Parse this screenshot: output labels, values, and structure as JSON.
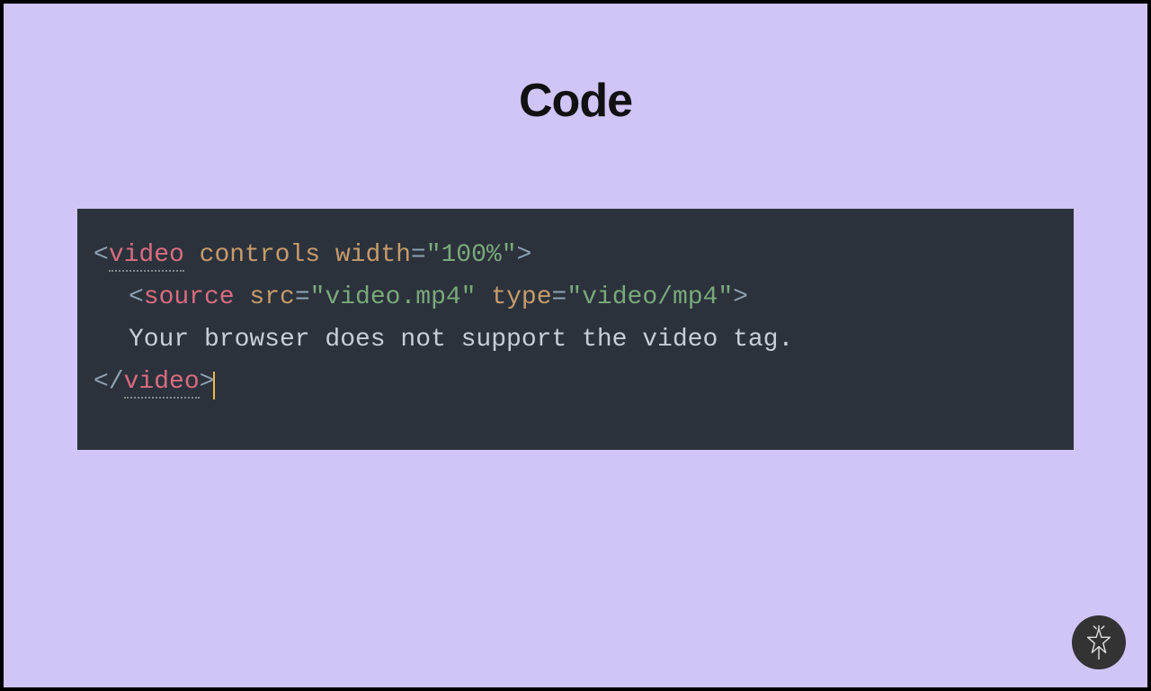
{
  "title": "Code",
  "code": {
    "line1": {
      "tag": "video",
      "attr1": "controls",
      "attr2": "width",
      "val2": "\"100%\""
    },
    "line2": {
      "tag": "source",
      "attr1": "src",
      "val1": "\"video.mp4\"",
      "attr2": "type",
      "val2": "\"video/mp4\""
    },
    "line3": {
      "text": "Your browser does not support the video tag."
    },
    "line4": {
      "tag": "video"
    }
  }
}
